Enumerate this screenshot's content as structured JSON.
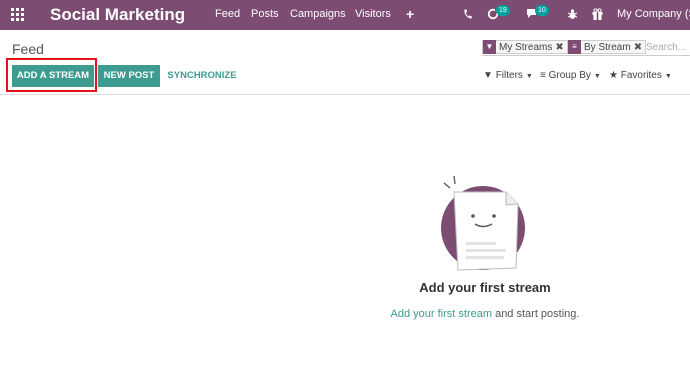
{
  "app": {
    "name": "Social Marketing",
    "menu": [
      "Feed",
      "Posts",
      "Campaigns",
      "Visitors"
    ],
    "plus_label": "+",
    "activity_count": "19",
    "message_count": "10",
    "company": "My Company (Sa"
  },
  "breadcrumb": "Feed",
  "buttons": {
    "add_stream": "ADD A STREAM",
    "new_post": "NEW POST",
    "synchronize": "SYNCHRONIZE"
  },
  "search": {
    "facets": [
      "My Streams",
      "By Stream"
    ],
    "placeholder": "Search..."
  },
  "filters": {
    "filters": "Filters",
    "group_by": "Group By",
    "favorites": "Favorites"
  },
  "helper": {
    "title": "Add your first stream",
    "link": "Add your first stream",
    "text": " and start posting."
  },
  "colors": {
    "brand": "#7c4c72",
    "accent": "#3d9b8f",
    "highlight": "#e0151b"
  },
  "icons": [
    "apps-grid-icon",
    "phone-icon",
    "activity-icon",
    "chat-icon",
    "bug-icon",
    "gift-icon",
    "filter-icon",
    "group-by-icon",
    "star-icon",
    "remove-icon"
  ]
}
